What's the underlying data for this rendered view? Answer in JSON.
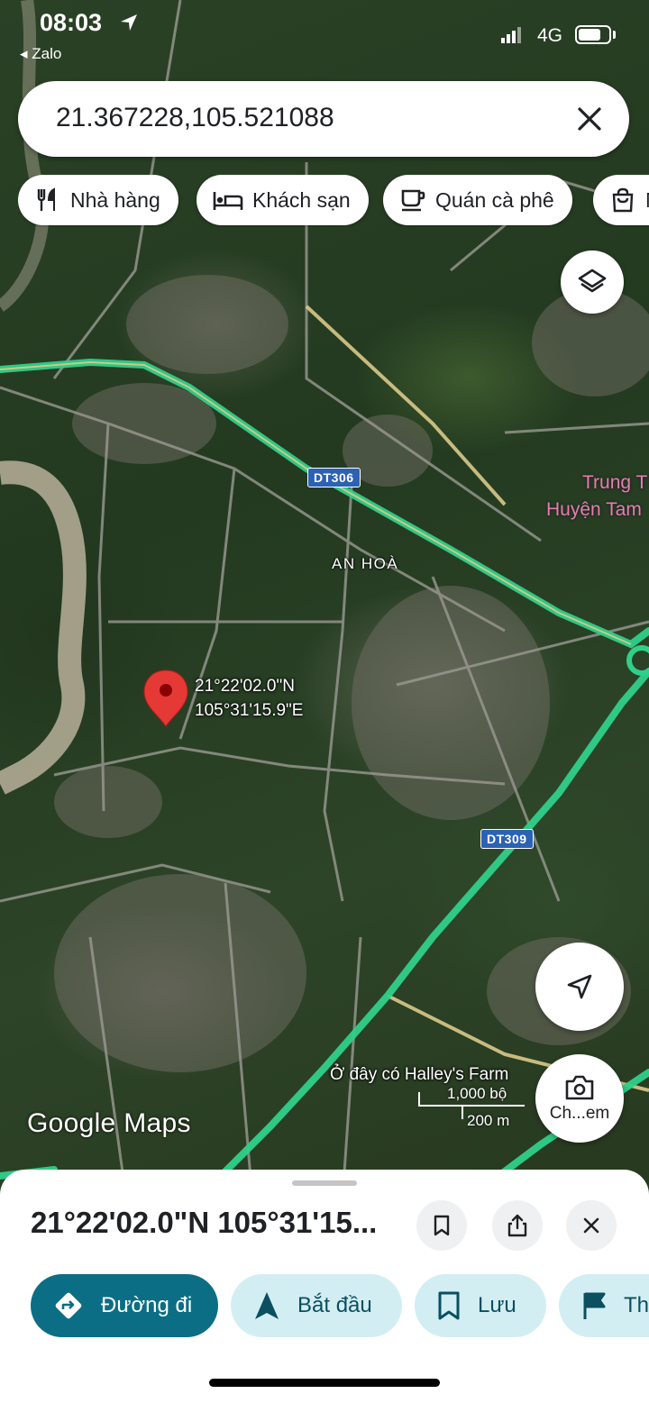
{
  "status_bar": {
    "time": "08:03",
    "back_app": "◂ Zalo",
    "network": "4G"
  },
  "search": {
    "value": "21.367228,105.521088"
  },
  "chips": [
    {
      "label": "Nhà hàng",
      "icon": "restaurant-icon"
    },
    {
      "label": "Khách sạn",
      "icon": "hotel-icon"
    },
    {
      "label": "Quán cà phê",
      "icon": "coffee-icon"
    },
    {
      "label": "M",
      "icon": "shopping-bag-icon"
    }
  ],
  "map": {
    "road_labels": [
      "DT306",
      "DT309"
    ],
    "area_label": "AN HOÀ",
    "poi_label_line1": "Trung T",
    "poi_label_line2": "Huyện Tam",
    "pin_coord_line1": "21°22'02.0\"N",
    "pin_coord_line2": "105°31'15.9\"E",
    "halley_label": "Ở đây có Halley's Farm",
    "scale_imperial": "1,000 bộ",
    "scale_metric": "200 m",
    "logo_google": "Google",
    "logo_maps": "Maps",
    "route_color": "#2fd08a",
    "pin_color": "#e53935"
  },
  "camera_button_label": "Ch...em",
  "sheet": {
    "title": "21°22'02.0\"N 105°31'15...",
    "actions": [
      {
        "label": "Đường đi",
        "icon": "directions-icon"
      },
      {
        "label": "Bắt đầu",
        "icon": "navigation-arrow-icon"
      },
      {
        "label": "Lưu",
        "icon": "bookmark-icon"
      },
      {
        "label": "Th",
        "icon": "flag-icon"
      }
    ]
  }
}
